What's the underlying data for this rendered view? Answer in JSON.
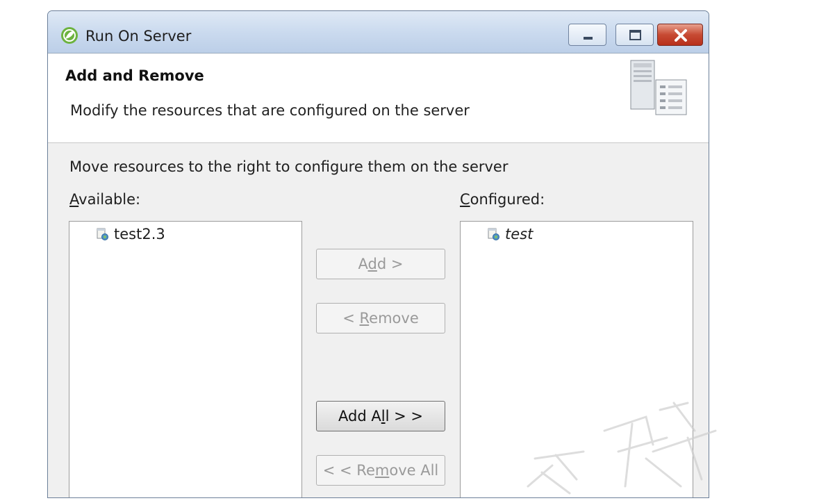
{
  "window": {
    "title": "Run On Server",
    "controls": {
      "minimize": "minimize-icon",
      "maximize": "maximize-icon",
      "close": "close-icon"
    }
  },
  "header": {
    "title": "Add and Remove",
    "description": "Modify the resources that are configured on the server",
    "graphic": "server-icon"
  },
  "instruction": "Move resources to the right to configure them on the server",
  "available": {
    "label_mnemonic": "A",
    "label_rest": "vailable:",
    "items": [
      {
        "label": "test2.3",
        "icon": "web-project-icon"
      }
    ]
  },
  "configured": {
    "label_mnemonic": "C",
    "label_rest": "onfigured:",
    "items": [
      {
        "label": "test",
        "icon": "web-project-icon",
        "italic": true
      }
    ]
  },
  "buttons": {
    "add": {
      "pre": "A",
      "mnemonic": "d",
      "post": "d >",
      "enabled": false
    },
    "remove": {
      "pre": "< ",
      "mnemonic": "R",
      "post": "emove",
      "enabled": false
    },
    "add_all": {
      "pre": "Add A",
      "mnemonic": "l",
      "post": "l > >",
      "enabled": true
    },
    "remove_all": {
      "pre": "< < Re",
      "mnemonic": "m",
      "post": "ove All",
      "enabled": false
    }
  },
  "colors": {
    "titlebar": "#c9d9ee",
    "close_button": "#c74a33",
    "app_icon": "#6db33f"
  }
}
